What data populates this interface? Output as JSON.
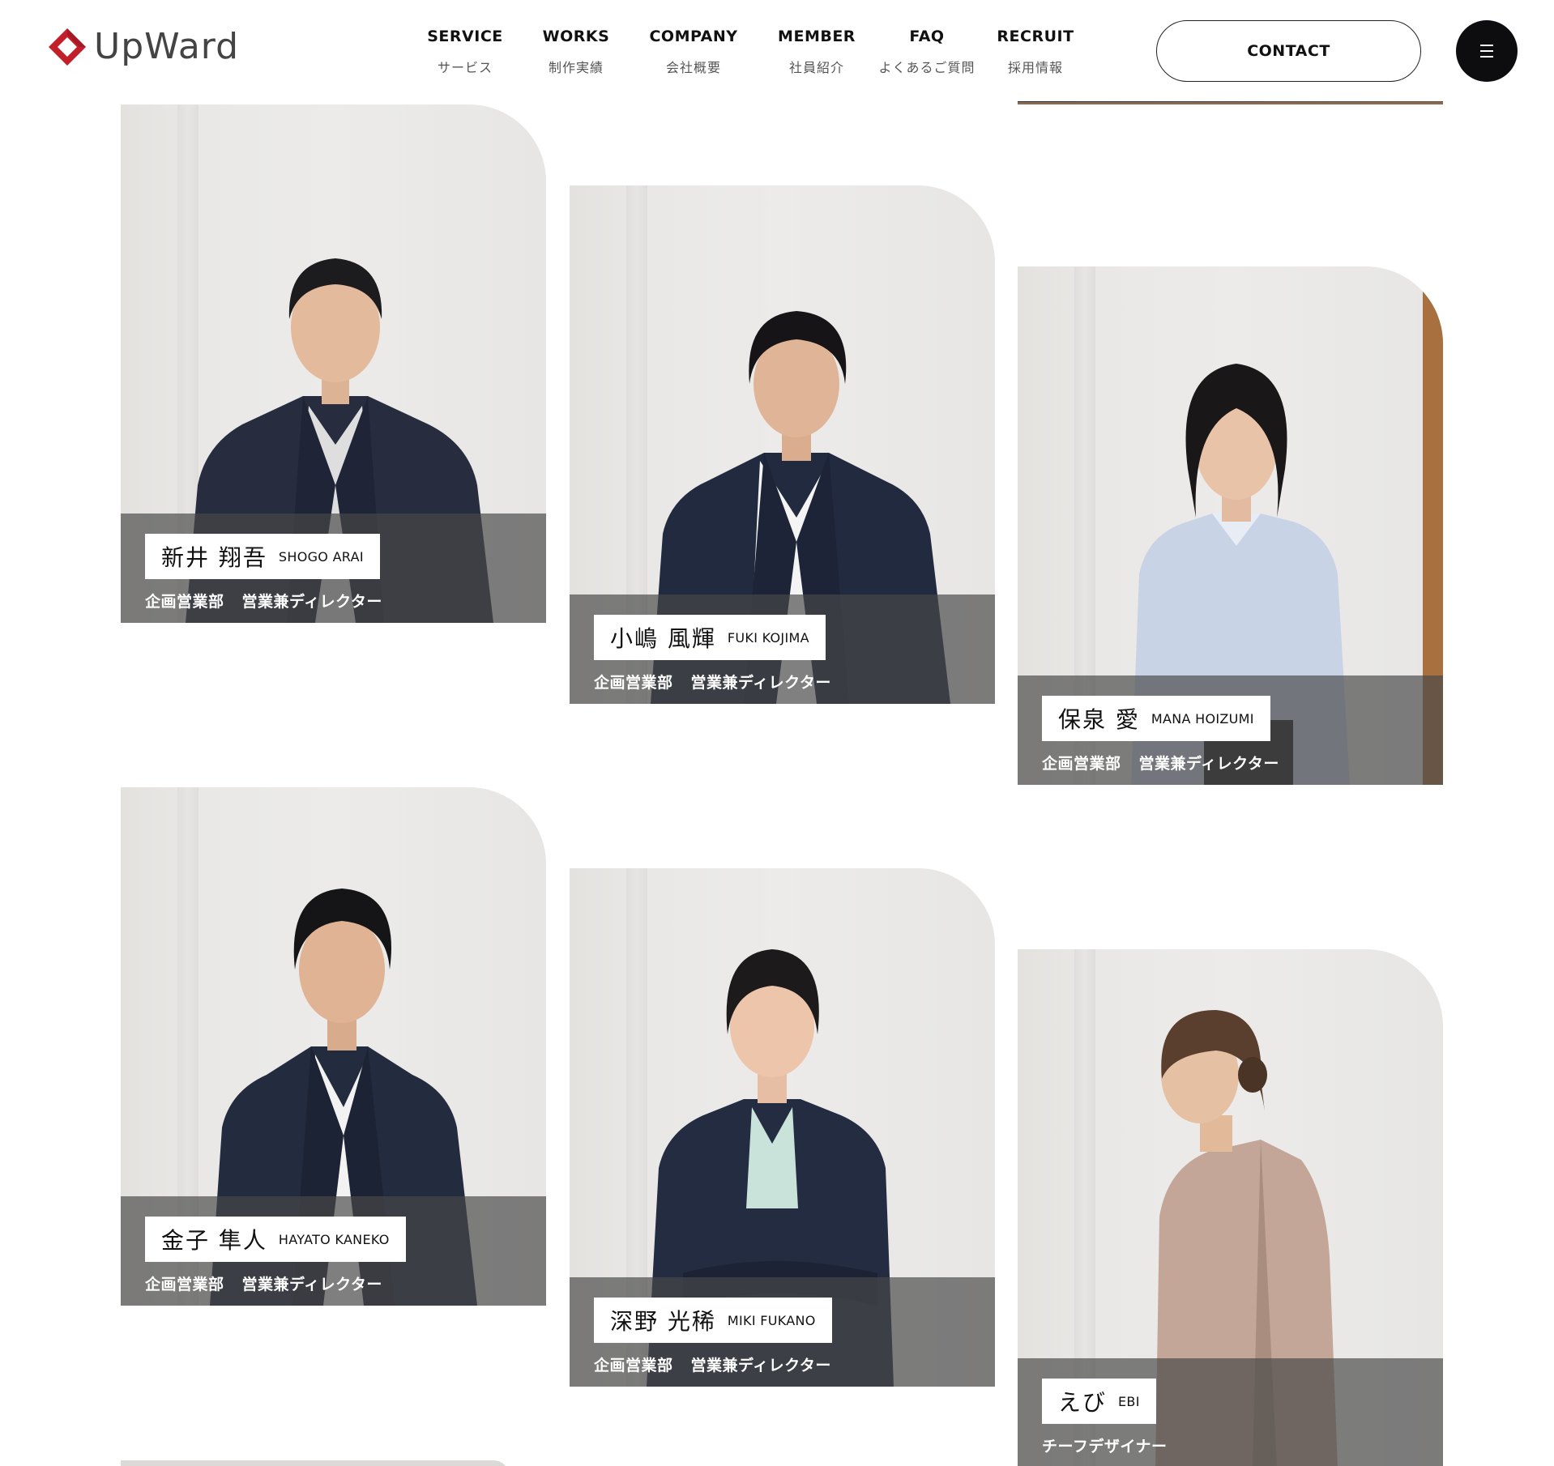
{
  "brand": {
    "name": "UpWard",
    "accent": "#c21f2b"
  },
  "nav": {
    "items": [
      {
        "en": "SERVICE",
        "jp": "サービス"
      },
      {
        "en": "WORKS",
        "jp": "制作実績"
      },
      {
        "en": "COMPANY",
        "jp": "会社概要"
      },
      {
        "en": "MEMBER",
        "jp": "社員紹介"
      },
      {
        "en": "FAQ",
        "jp": "よくあるご質問"
      },
      {
        "en": "RECRUIT",
        "jp": "採用情報"
      }
    ],
    "contact_label": "CONTACT",
    "menu_icon": "menu-icon"
  },
  "members": [
    {
      "name_jp": "新井 翔吾",
      "name_en": "SHOGO ARAI",
      "dept": "企画営業部",
      "title": "営業兼ディレクター"
    },
    {
      "name_jp": "小嶋 風輝",
      "name_en": "FUKI KOJIMA",
      "dept": "企画営業部",
      "title": "営業兼ディレクター"
    },
    {
      "name_jp": "保泉 愛",
      "name_en": "MANA HOIZUMI",
      "dept": "企画営業部",
      "title": "営業兼ディレクター"
    },
    {
      "name_jp": "金子 隼人",
      "name_en": "HAYATO KANEKO",
      "dept": "企画営業部",
      "title": "営業兼ディレクター"
    },
    {
      "name_jp": "深野 光稀",
      "name_en": "MIKI FUKANO",
      "dept": "企画営業部",
      "title": "営業兼ディレクター"
    },
    {
      "name_jp": "えび",
      "name_en": "EBI",
      "dept": "",
      "title": "チーフデザイナー"
    }
  ],
  "colors": {
    "caption_bg": "#484848",
    "menu_button": "#0d0d0f",
    "text": "#111111"
  }
}
